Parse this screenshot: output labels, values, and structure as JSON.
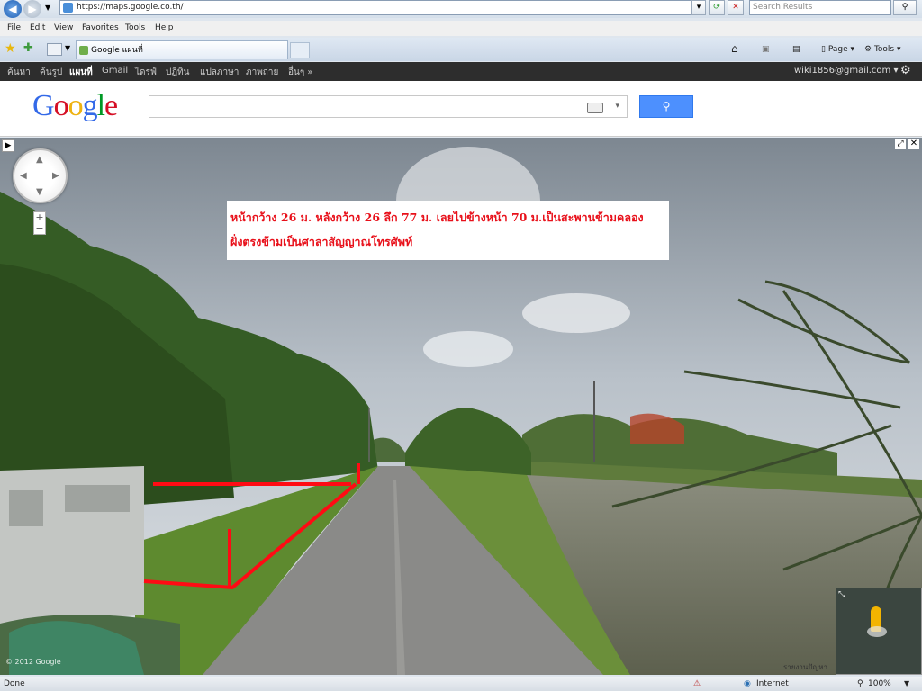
{
  "browser": {
    "url": "https://maps.google.co.th/",
    "search_placeholder": "Search Results",
    "tab_title": "Google แผนที่",
    "menu": [
      "File",
      "Edit",
      "View",
      "Favorites",
      "Tools",
      "Help"
    ],
    "command_bar": {
      "page": "Page",
      "tools": "Tools"
    }
  },
  "google_bar": {
    "links": [
      "ค้นหา",
      "ค้นรูป",
      "แผนที่",
      "Gmail",
      "ไดรฟ์",
      "ปฏิทิน",
      "แปลภาษา",
      "ภาพถ่าย",
      "อื่นๆ »"
    ],
    "account": "wiki1856@gmail.com ▾"
  },
  "header": {
    "logo": "Google",
    "search_value": "",
    "logo_colors": [
      "#3369e8",
      "#d50f25",
      "#eeb211",
      "#3369e8",
      "#009925",
      "#d50f25"
    ]
  },
  "streetview": {
    "annotation_line1": "หน้ากว้าง 26 ม. หลังกว้าง 26 ลึก 77 ม. เลยไปข้างหน้า 70 ม.เป็นสะพานข้ามคลอง",
    "annotation_line2": "ฝั่งตรงข้ามเป็นศาลาสัญญาณโทรศัพท์",
    "annotation_color": "#e8101a",
    "copyright": "© 2012 Google",
    "report": "รายงานปัญหา"
  },
  "status_bar": {
    "left": "Done",
    "zone": "Internet",
    "zoom": "100%"
  }
}
